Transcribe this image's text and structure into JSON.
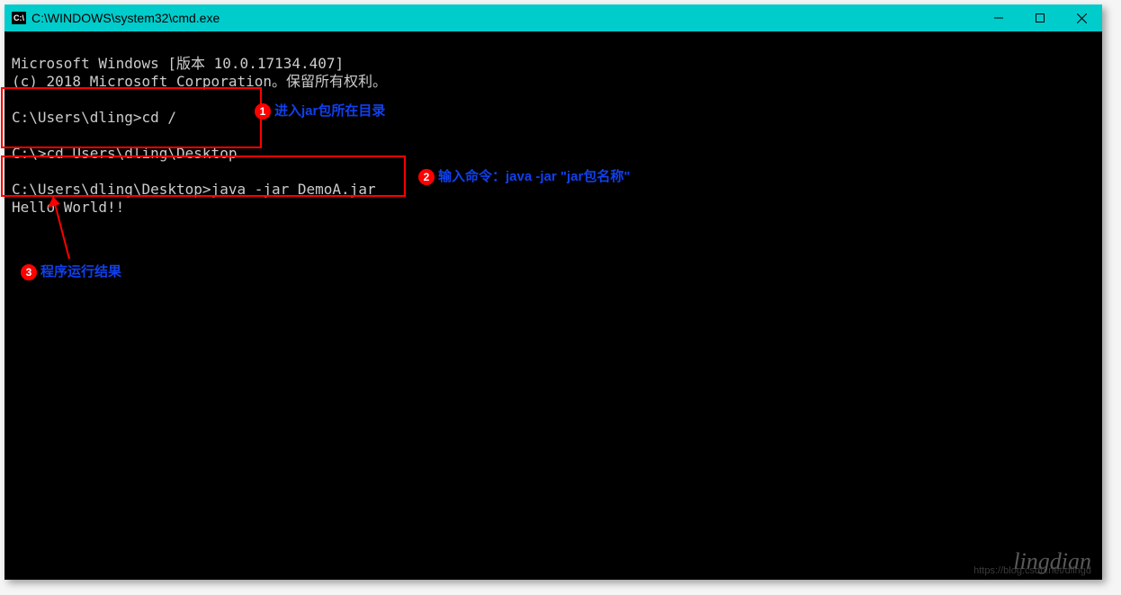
{
  "titlebar": {
    "icon_text": "C:\\",
    "title": "C:\\WINDOWS\\system32\\cmd.exe"
  },
  "terminal": {
    "line1": "Microsoft Windows [版本 10.0.17134.407]",
    "line2": "(c) 2018 Microsoft Corporation。保留所有权利。",
    "line3": "",
    "line4": "C:\\Users\\dling>cd /",
    "line5": "",
    "line6": "C:\\>cd Users\\dling\\Desktop",
    "line7": "",
    "line8": "C:\\Users\\dling\\Desktop>java -jar DemoA.jar",
    "line9": "Hello World!!"
  },
  "annotations": {
    "a1": {
      "num": "1",
      "text": "进入jar包所在目录"
    },
    "a2": {
      "num": "2",
      "text": "输入命令：java -jar \"jar包名称\""
    },
    "a3": {
      "num": "3",
      "text": "程序运行结果"
    }
  },
  "watermark": {
    "name": "lingdian",
    "url": "https://blog.csdn.net/dlingd"
  }
}
